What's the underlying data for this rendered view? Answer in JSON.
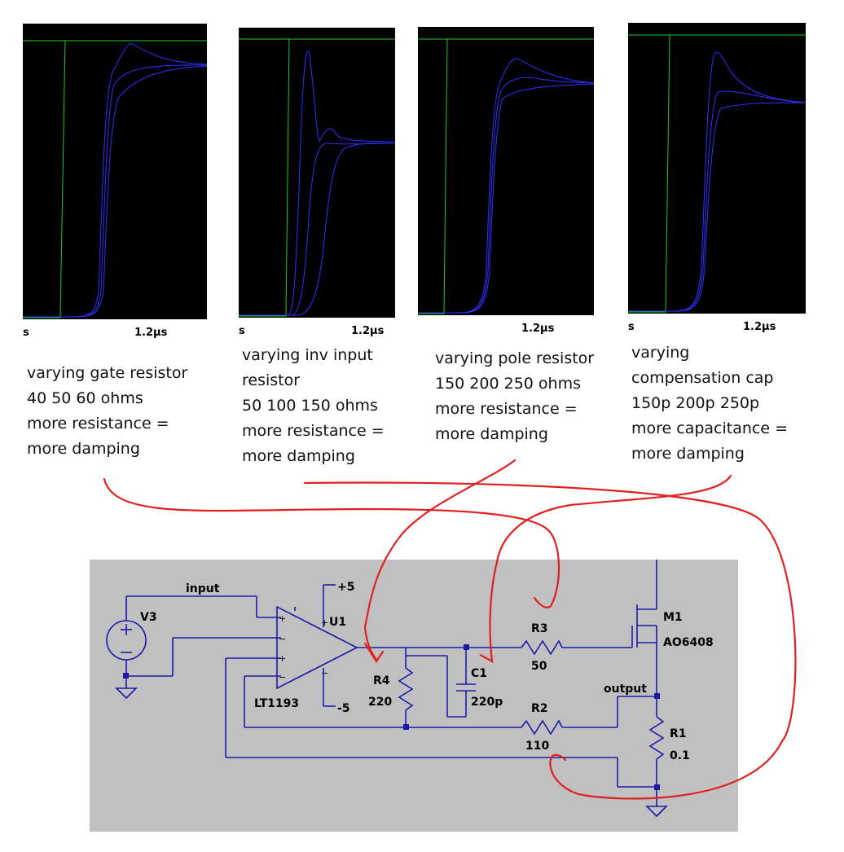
{
  "plots": [
    {
      "tick_left": "s",
      "tick_right": "1.2µs"
    },
    {
      "tick_left": "s",
      "tick_right": "1.2µs"
    },
    {
      "tick_left": "",
      "tick_right": "1.2µs"
    },
    {
      "tick_left": "s",
      "tick_right": "1.2µs"
    }
  ],
  "captions": [
    {
      "lines": [
        "varying gate resistor",
        "40 50 60 ohms",
        "more resistance =",
        "more damping"
      ]
    },
    {
      "lines": [
        "varying inv input",
        "resistor",
        "50 100 150 ohms",
        "more resistance =",
        "more damping"
      ]
    },
    {
      "lines": [
        "varying pole resistor",
        "150 200 250 ohms",
        "more resistance =",
        "more damping"
      ]
    },
    {
      "lines": [
        "varying",
        "compensation cap",
        "150p 200p 250p",
        "more capacitance =",
        "more damping"
      ]
    }
  ],
  "schematic": {
    "input_label": "input",
    "output_label": "output",
    "v3": "V3",
    "u1": "U1",
    "u1_model": "LT1193",
    "vpos": "+5",
    "vneg": "-5",
    "m1": "M1",
    "m1_model": "AO6408",
    "r4": "R4",
    "r4_val": "220",
    "c1": "C1",
    "c1_val": "220p",
    "r3": "R3",
    "r3_val": "50",
    "r2": "R2",
    "r2_val": "110",
    "r1": "R1",
    "r1_val": "0.1"
  },
  "colors": {
    "plot_bg": "#000000",
    "input_trace": "#22cc22",
    "output_trace": "#3030ff",
    "wire": "#1a1aa8",
    "schematic_bg": "#c0c0c0",
    "annotation": "#e02020"
  }
}
